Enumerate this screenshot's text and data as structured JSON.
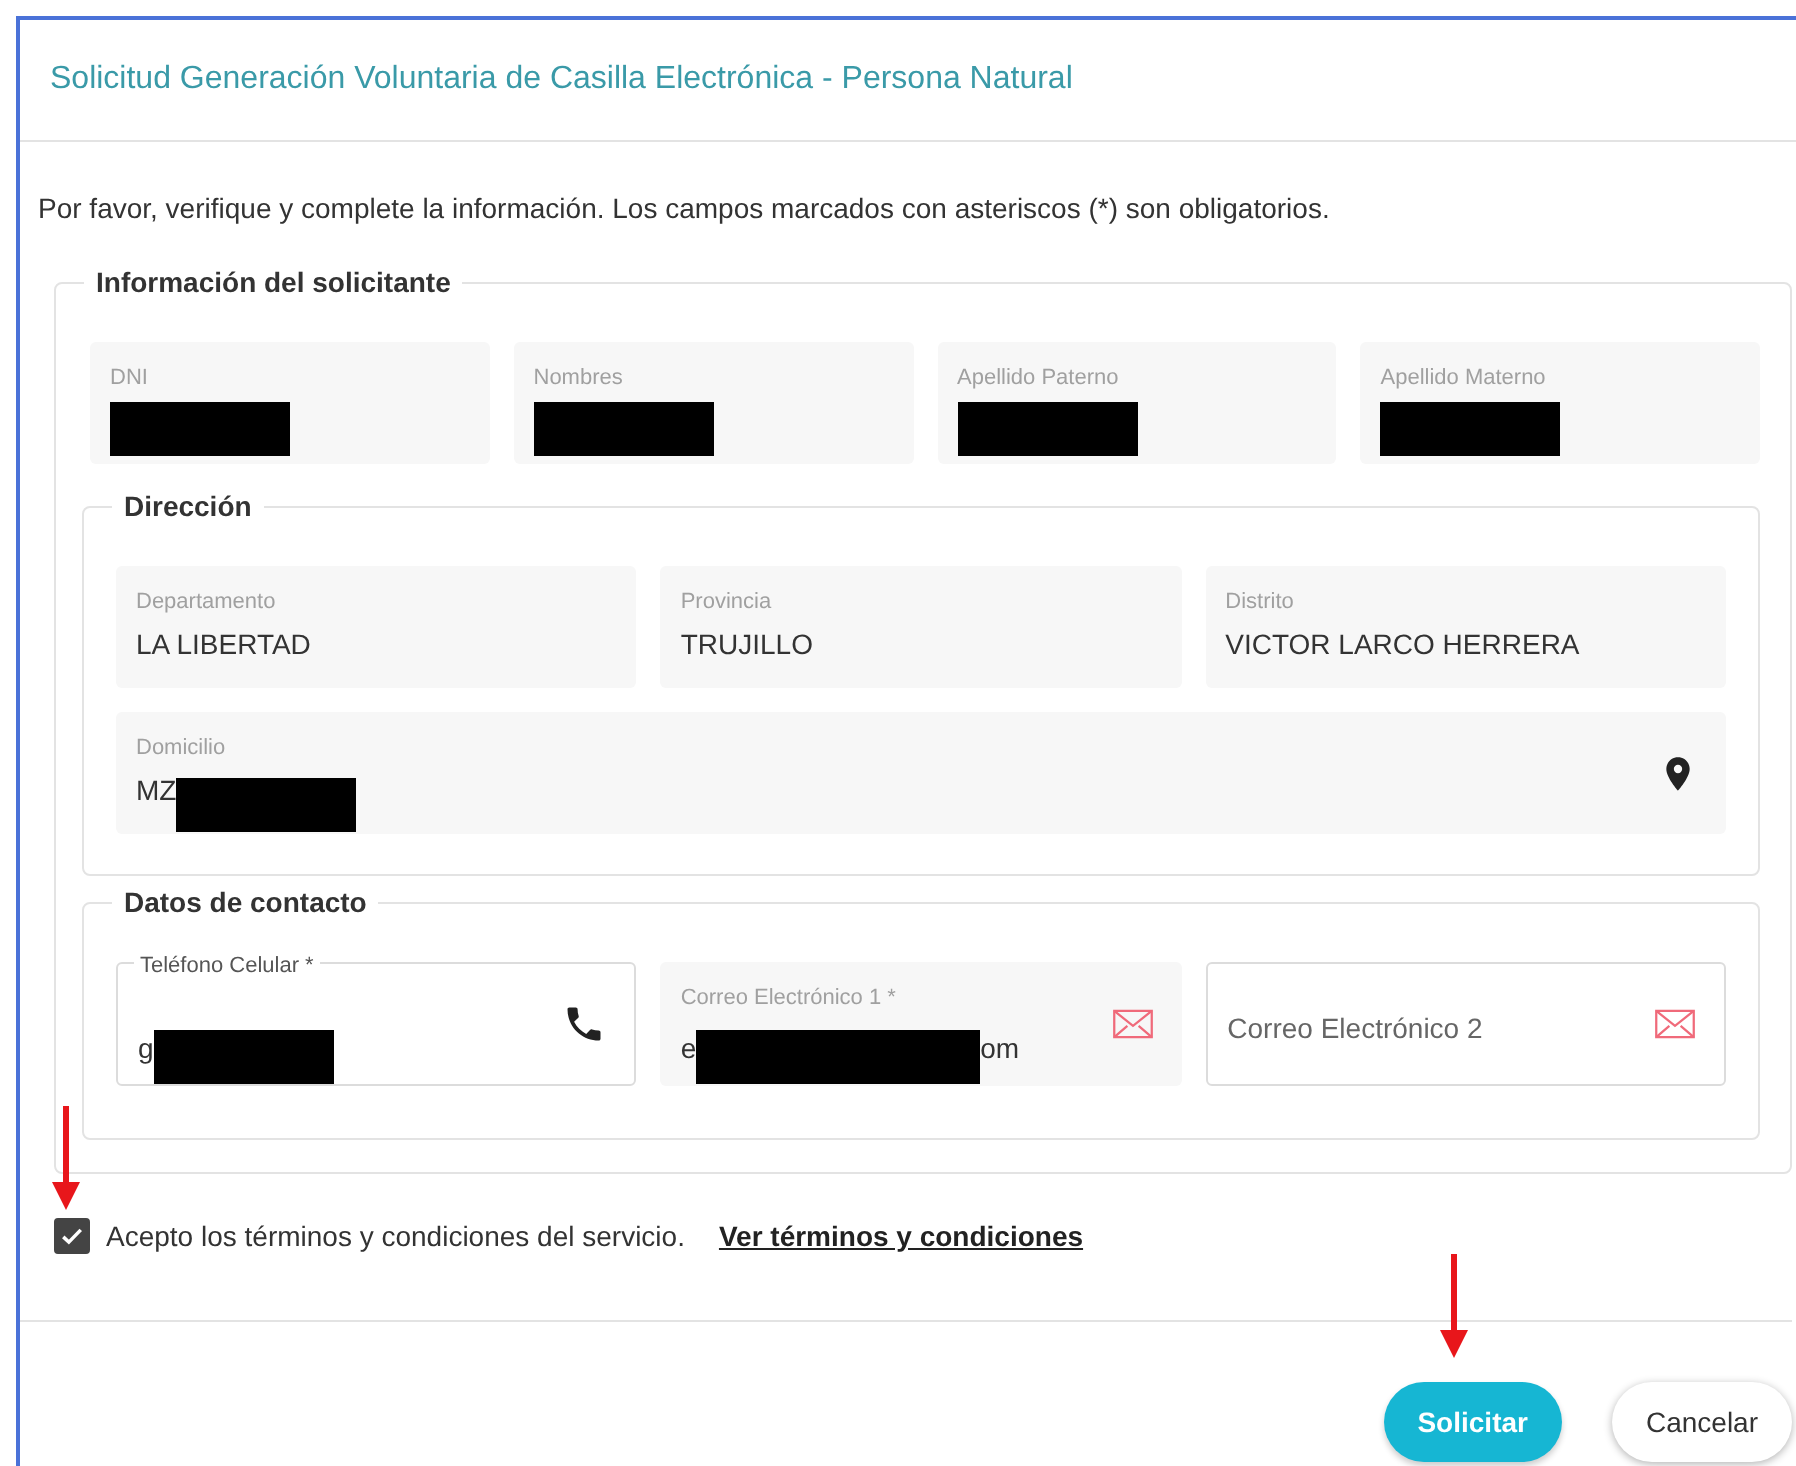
{
  "dialog": {
    "title": "Solicitud Generación Voluntaria de Casilla Electrónica - Persona Natural",
    "instructions": "Por favor, verifique y complete la información. Los campos marcados con asteriscos (*) son obligatorios."
  },
  "applicant": {
    "legend": "Información del solicitante",
    "fields": [
      {
        "label": "DNI",
        "readonly": true,
        "redacted": true
      },
      {
        "label": "Nombres",
        "readonly": true,
        "redacted": true
      },
      {
        "label": "Apellido Paterno",
        "readonly": true,
        "redacted": true
      },
      {
        "label": "Apellido Materno",
        "readonly": true,
        "redacted": true
      }
    ],
    "address": {
      "legend": "Dirección",
      "fields": [
        {
          "label": "Departamento",
          "kind": "text",
          "readonly": true,
          "value": "LA LIBERTAD"
        },
        {
          "label": "Provincia",
          "kind": "text",
          "readonly": true,
          "value": "TRUJILLO"
        },
        {
          "label": "Distrito",
          "kind": "text",
          "readonly": true,
          "value": "VICTOR LARCO HERRERA"
        },
        {
          "label": "Domicilio",
          "kind": "address",
          "readonly": true,
          "value": "MZ",
          "redacted": true
        }
      ]
    },
    "contact": {
      "legend": "Datos de contacto",
      "fields": [
        {
          "label": "Teléfono Celular *",
          "kind": "phone",
          "readonly": false,
          "value": "g",
          "redacted": true
        },
        {
          "label": "Correo Electrónico 1 *",
          "kind": "email",
          "readonly": true,
          "value": "e",
          "redacted": true,
          "value_end": "om"
        },
        {
          "placeholder": "Correo Electrónico 2",
          "kind": "email",
          "readonly": false
        }
      ]
    }
  },
  "terms": {
    "checked": true,
    "label": "Acepto los términos y condiciones del servicio.",
    "link": "Ver términos y condiciones"
  },
  "buttons": [
    {
      "label": "Solicitar",
      "kind": "primary"
    },
    {
      "label": "Cancelar",
      "kind": "secondary"
    }
  ]
}
